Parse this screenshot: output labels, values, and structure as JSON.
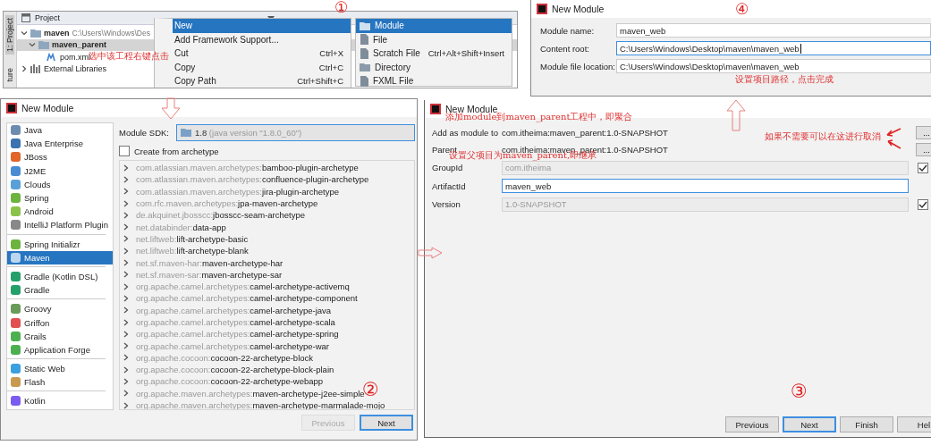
{
  "project_panel": {
    "side_tabs": [
      "1: Project",
      "ture"
    ],
    "header": "Project",
    "tree": [
      {
        "name": "maven",
        "path": "C:\\Users\\Windows\\Des",
        "expanded": true,
        "selected": false,
        "children": [
          {
            "name": "maven_parent",
            "expanded": true,
            "selected": true,
            "children": [
              {
                "name": "pom.xml",
                "selected": false
              }
            ]
          }
        ]
      },
      {
        "name": "External Libraries",
        "expanded": false,
        "selected": false
      }
    ]
  },
  "context_menu": {
    "items": [
      {
        "label": "New",
        "selected": true
      },
      {
        "label": "Add Framework Support...",
        "selected": false
      },
      {
        "label": "Cut",
        "shortcut": "Ctrl+X",
        "selected": false
      },
      {
        "label": "Copy",
        "shortcut": "Ctrl+C",
        "selected": false
      },
      {
        "label": "Copy Path",
        "shortcut": "Ctrl+Shift+C",
        "selected": false
      }
    ]
  },
  "submenu": {
    "items": [
      {
        "label": "Module",
        "selected": true
      },
      {
        "label": "File",
        "selected": false
      },
      {
        "label": "Scratch File",
        "shortcut": "Ctrl+Alt+Shift+Insert",
        "selected": false
      },
      {
        "label": "Directory",
        "selected": false
      },
      {
        "label": "FXML File",
        "selected": false
      }
    ]
  },
  "name_dialog": {
    "title": "New Module",
    "fields": [
      {
        "label": "Module name:",
        "value": "maven_web",
        "focused": false
      },
      {
        "label": "Content root:",
        "value": "C:\\Users\\Windows\\Desktop\\maven\\maven_web",
        "focused": true
      },
      {
        "label": "Module file location:",
        "value": "C:\\Users\\Windows\\Desktop\\maven\\maven_web",
        "focused": false
      }
    ]
  },
  "type_dialog": {
    "title": "New Module",
    "module_types": [
      [
        {
          "label": "Java",
          "selected": false
        },
        {
          "label": "Java Enterprise",
          "selected": false
        },
        {
          "label": "JBoss",
          "selected": false
        },
        {
          "label": "J2ME",
          "selected": false
        },
        {
          "label": "Clouds",
          "selected": false
        },
        {
          "label": "Spring",
          "selected": false
        },
        {
          "label": "Android",
          "selected": false
        },
        {
          "label": "IntelliJ Platform Plugin",
          "selected": false
        }
      ],
      [
        {
          "label": "Spring Initializr",
          "selected": false
        },
        {
          "label": "Maven",
          "selected": true
        }
      ],
      [
        {
          "label": "Gradle (Kotlin DSL)",
          "selected": false
        },
        {
          "label": "Gradle",
          "selected": false
        }
      ],
      [
        {
          "label": "Groovy",
          "selected": false
        },
        {
          "label": "Griffon",
          "selected": false
        },
        {
          "label": "Grails",
          "selected": false
        },
        {
          "label": "Application Forge",
          "selected": false
        }
      ],
      [
        {
          "label": "Static Web",
          "selected": false
        },
        {
          "label": "Flash",
          "selected": false
        }
      ],
      [
        {
          "label": "Kotlin",
          "selected": false
        }
      ]
    ],
    "sdk_label": "Module SDK:",
    "sdk": {
      "version": "1.8",
      "detail": "(java version \"1.8.0_60\")"
    },
    "archetype_checkbox": {
      "label": "Create from archetype",
      "checked": false
    },
    "archetypes": [
      {
        "group": "com.atlassian.maven.archetypes:",
        "artifact": "bamboo-plugin-archetype"
      },
      {
        "group": "com.atlassian.maven.archetypes:",
        "artifact": "confluence-plugin-archetype"
      },
      {
        "group": "com.atlassian.maven.archetypes:",
        "artifact": "jira-plugin-archetype"
      },
      {
        "group": "com.rfc.maven.archetypes:",
        "artifact": "jpa-maven-archetype"
      },
      {
        "group": "de.akquinet.jbosscc:",
        "artifact": "jbosscc-seam-archetype"
      },
      {
        "group": "net.databinder:",
        "artifact": "data-app"
      },
      {
        "group": "net.liftweb:",
        "artifact": "lift-archetype-basic"
      },
      {
        "group": "net.liftweb:",
        "artifact": "lift-archetype-blank"
      },
      {
        "group": "net.sf.maven-har:",
        "artifact": "maven-archetype-har"
      },
      {
        "group": "net.sf.maven-sar:",
        "artifact": "maven-archetype-sar"
      },
      {
        "group": "org.apache.camel.archetypes:",
        "artifact": "camel-archetype-activemq"
      },
      {
        "group": "org.apache.camel.archetypes:",
        "artifact": "camel-archetype-component"
      },
      {
        "group": "org.apache.camel.archetypes:",
        "artifact": "camel-archetype-java"
      },
      {
        "group": "org.apache.camel.archetypes:",
        "artifact": "camel-archetype-scala"
      },
      {
        "group": "org.apache.camel.archetypes:",
        "artifact": "camel-archetype-spring"
      },
      {
        "group": "org.apache.camel.archetypes:",
        "artifact": "camel-archetype-war"
      },
      {
        "group": "org.apache.cocoon:",
        "artifact": "cocoon-22-archetype-block"
      },
      {
        "group": "org.apache.cocoon:",
        "artifact": "cocoon-22-archetype-block-plain"
      },
      {
        "group": "org.apache.cocoon:",
        "artifact": "cocoon-22-archetype-webapp"
      },
      {
        "group": "org.apache.maven.archetypes:",
        "artifact": "maven-archetype-j2ee-simple"
      },
      {
        "group": "org.apache.maven.archetypes:",
        "artifact": "maven-archetype-marmalade-mojo"
      }
    ],
    "buttons": [
      {
        "label": "Previous",
        "disabled": true,
        "default": false
      },
      {
        "label": "Next",
        "disabled": false,
        "default": true
      }
    ]
  },
  "maven_dialog": {
    "title": "New Module",
    "info_rows": [
      {
        "label": "Add as module to",
        "value": "com.itheima:maven_parent:1.0-SNAPSHOT",
        "button": "..."
      },
      {
        "label": "Parent",
        "value": "com.itheima:maven_parent:1.0-SNAPSHOT",
        "button": "..."
      }
    ],
    "fields": [
      {
        "label": "GroupId",
        "value": "com.itheima",
        "disabled": true,
        "checked": true
      },
      {
        "label": "ArtifactId",
        "value": "maven_web",
        "disabled": false
      },
      {
        "label": "Version",
        "value": "1.0-SNAPSHOT",
        "disabled": true,
        "checked": true
      }
    ],
    "buttons": [
      {
        "label": "Previous",
        "default": false
      },
      {
        "label": "Next",
        "default": true
      },
      {
        "label": "Finish",
        "default": false
      },
      {
        "label": "Hel",
        "default": false
      }
    ]
  },
  "annotations": [
    {
      "kind": "note",
      "text": "选中该工程右键点击"
    },
    {
      "kind": "step",
      "text": "①"
    },
    {
      "kind": "step",
      "text": "②"
    },
    {
      "kind": "step",
      "text": "③"
    },
    {
      "kind": "step",
      "text": "④"
    },
    {
      "kind": "note",
      "text": "设置项目路径，点击完成"
    },
    {
      "kind": "note",
      "text": "添加module到maven_parent工程中，即聚合"
    },
    {
      "kind": "note",
      "text": "如果不需要可以在这进行取消"
    },
    {
      "kind": "note",
      "text": "设置父项目为maven_parent,即继承"
    }
  ]
}
